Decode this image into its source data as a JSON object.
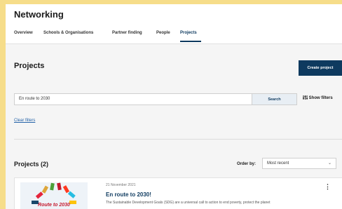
{
  "header": {
    "title": "Networking",
    "tabs": [
      {
        "label": "Overview",
        "active": false
      },
      {
        "label": "Schools & Organisations",
        "active": false
      },
      {
        "label": "Partner finding",
        "active": false
      },
      {
        "label": "People",
        "active": false
      },
      {
        "label": "Projects",
        "active": true
      }
    ]
  },
  "projects": {
    "title": "Projects",
    "create_label": "Create project",
    "search": {
      "value": "En route to 2030",
      "button_label": "Search"
    },
    "filters_toggle_label": "Show filters",
    "filters_icon": "sliders-icon",
    "clear_filters_label": "Clear filters",
    "results_title": "Projects (2)",
    "order": {
      "label": "Order by:",
      "selected": "Most recent"
    }
  },
  "results": [
    {
      "date": "21 November 2021",
      "title": "En route to 2030!",
      "description": "The Sustainable Development Goals (SDG) are a universal call to action to end poverty, protect the planet",
      "image_text": "Route to 2030"
    }
  ],
  "colors": {
    "accent": "#0e3a5f",
    "link": "#2563a8",
    "page_bg": "#f6dd8a"
  }
}
